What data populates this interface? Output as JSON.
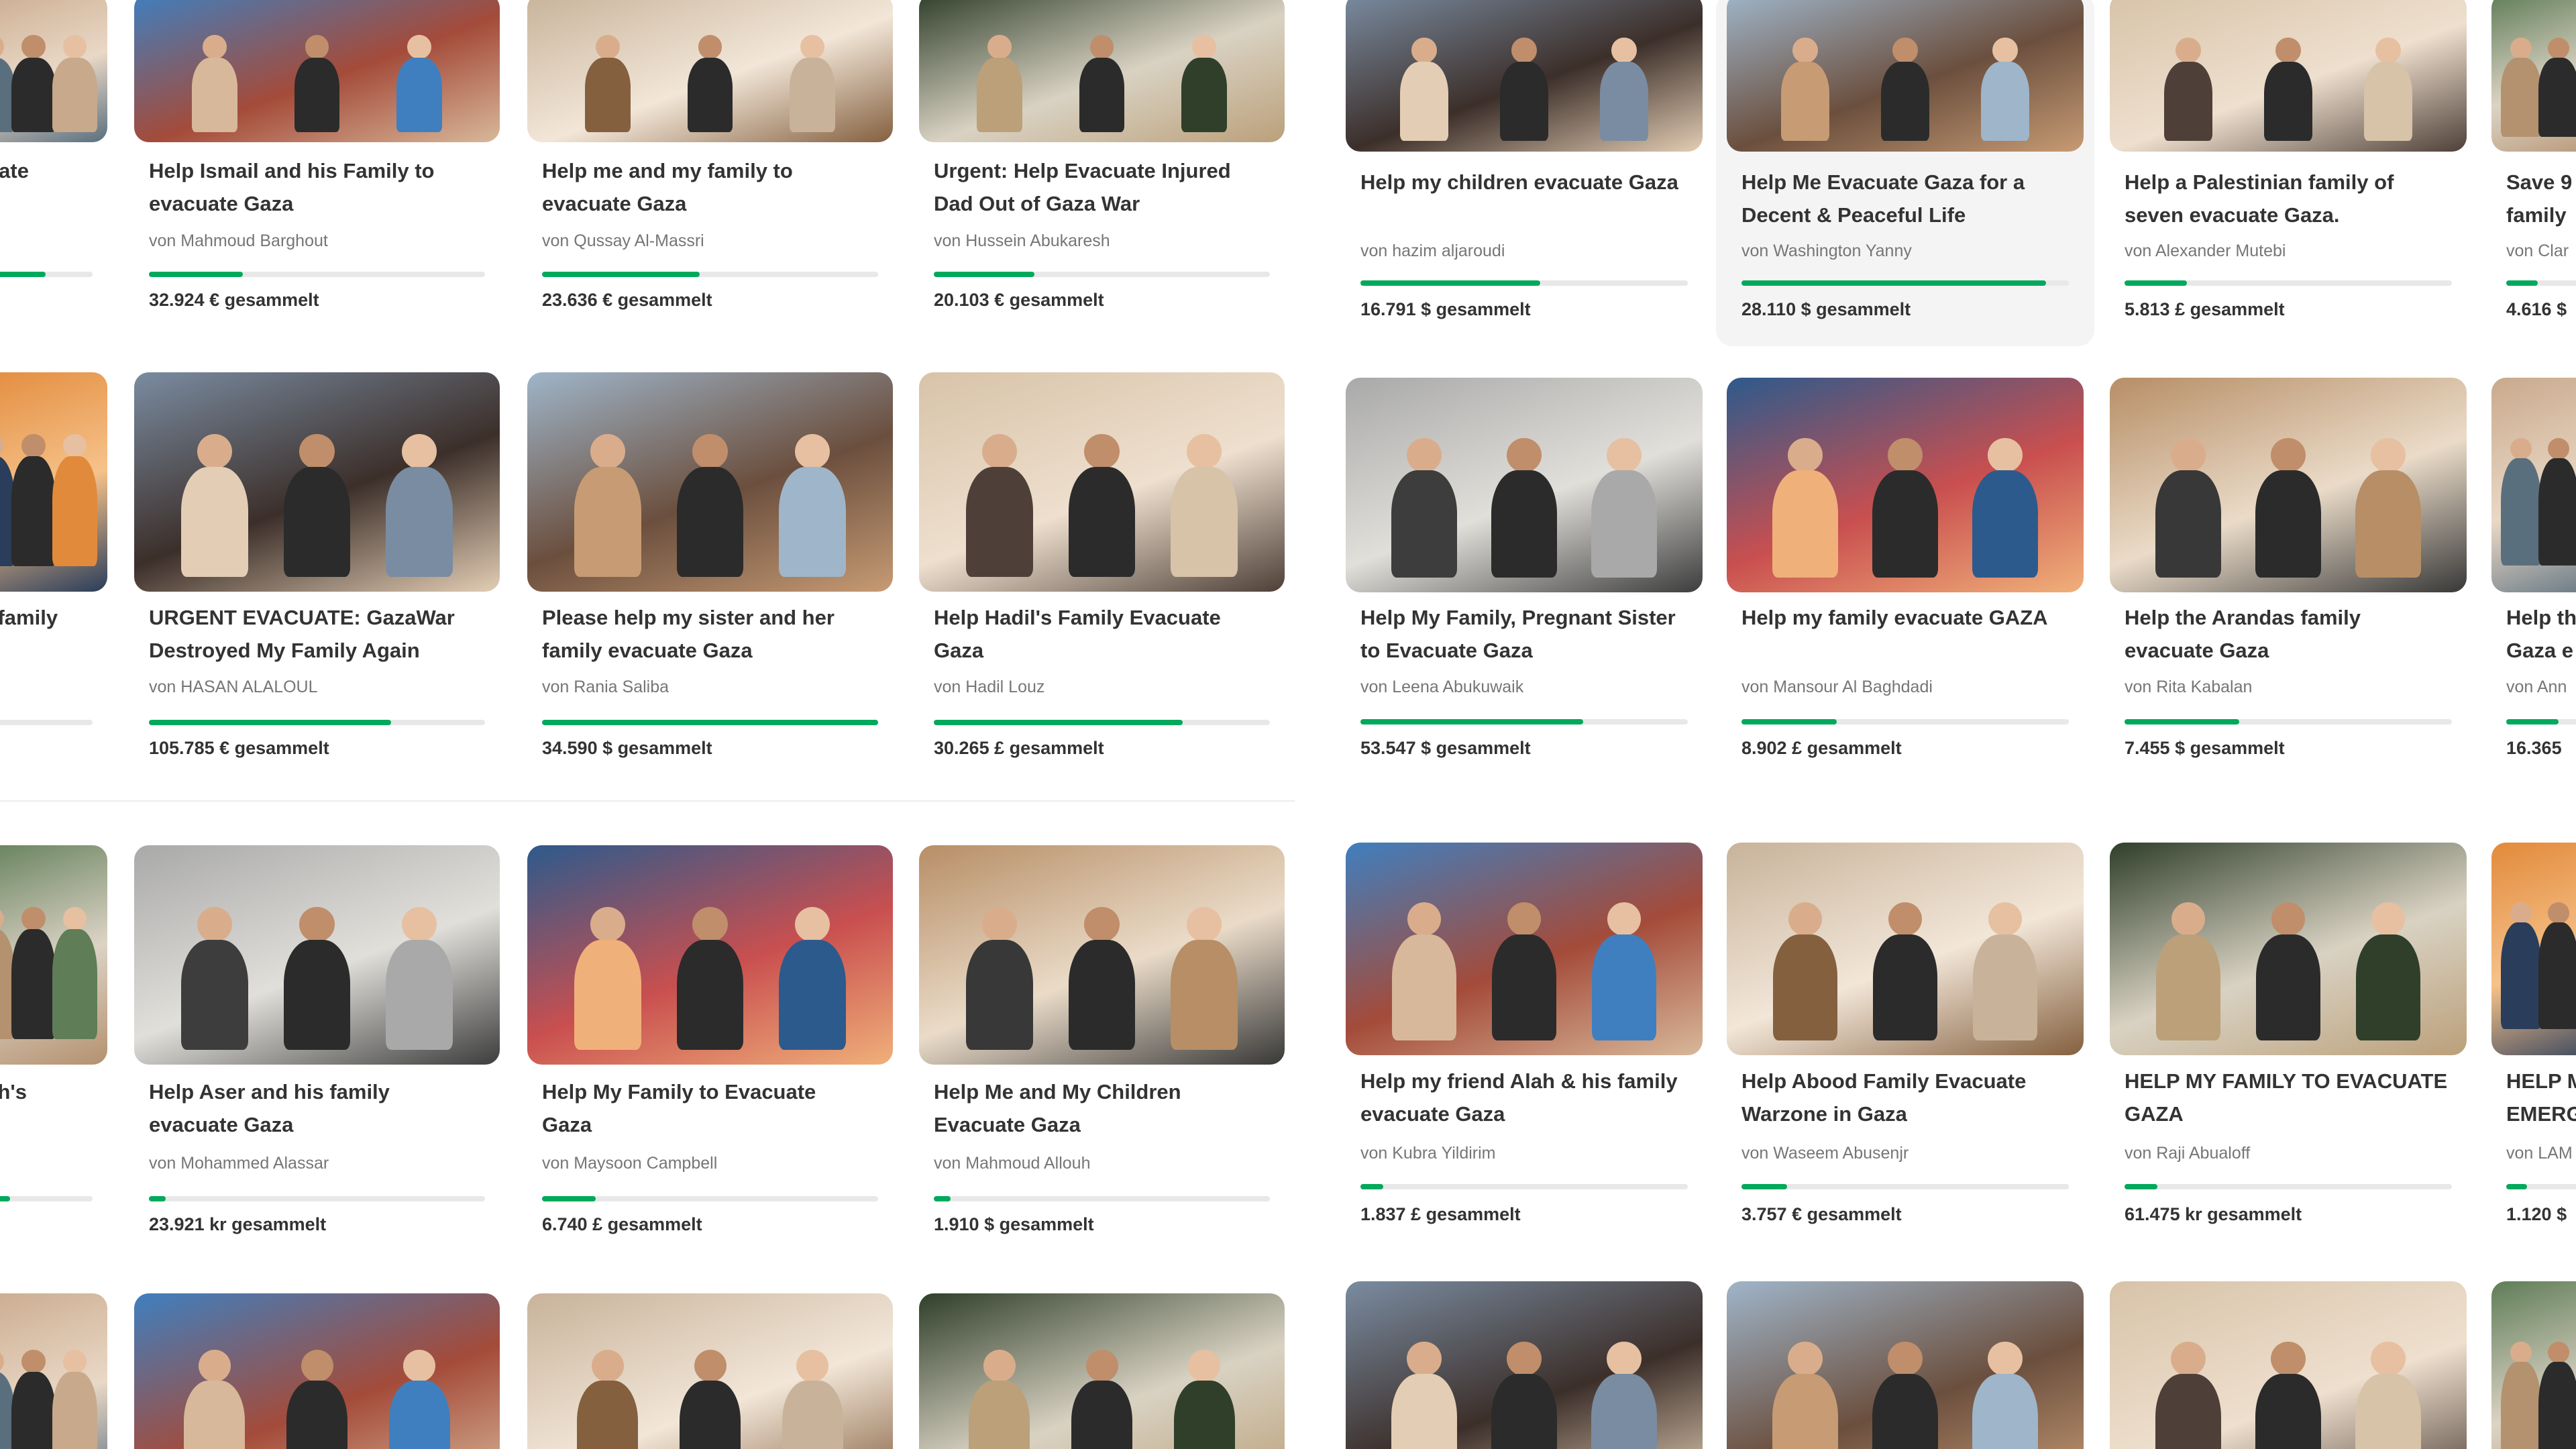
{
  "currency_label": "gesammelt",
  "left_panel": {
    "rows": [
      [
        {
          "title": [
            "",
            "cuate"
          ],
          "organizer": "",
          "raised": "",
          "progress": 0.6
        },
        {
          "title": [
            "Help Ismail and his Family to",
            "evacuate Gaza"
          ],
          "organizer": "von Mahmoud Barghout",
          "raised": "32.924 € gesammelt",
          "progress": 0.28
        },
        {
          "title": [
            "Help me and my family to",
            "evacuate Gaza"
          ],
          "organizer": "von Qussay Al-Massri",
          "raised": "23.636 € gesammelt",
          "progress": 0.47
        },
        {
          "title": [
            "Urgent: Help Evacuate Injured",
            "Dad Out of Gaza War"
          ],
          "organizer": "von Hussein Abukaresh",
          "raised": "20.103 € gesammelt",
          "progress": 0.3
        }
      ],
      [
        {
          "title": [
            "is family",
            ""
          ],
          "organizer": "",
          "raised": "",
          "progress": 0.2
        },
        {
          "title": [
            "URGENT EVACUATE: GazaWar",
            "Destroyed My Family Again"
          ],
          "organizer": "von HASAN ALALOUL",
          "raised": "105.785 € gesammelt",
          "progress": 0.72
        },
        {
          "title": [
            "Please help my sister and her",
            "family evacuate Gaza"
          ],
          "organizer": "von Rania Saliba",
          "raised": "34.590 $ gesammelt",
          "progress": 1.0
        },
        {
          "title": [
            "Help Hadil's Family Evacuate",
            "Gaza"
          ],
          "organizer": "von Hadil Louz",
          "raised": "30.265 £ gesammelt",
          "progress": 0.74
        }
      ],
      [
        {
          "title": [
            "llah's",
            ""
          ],
          "organizer": "",
          "raised": "",
          "progress": 0.3
        },
        {
          "title": [
            "Help Aser and his family",
            "evacuate Gaza"
          ],
          "organizer": "von Mohammed Alassar",
          "raised": "23.921 kr gesammelt",
          "progress": 0.05
        },
        {
          "title": [
            "Help My Family to Evacuate",
            "Gaza"
          ],
          "organizer": "von Maysoon Campbell",
          "raised": "6.740 £ gesammelt",
          "progress": 0.16
        },
        {
          "title": [
            "Help Me and My Children",
            "Evacuate Gaza"
          ],
          "organizer": "von Mahmoud Allouh",
          "raised": "1.910 $ gesammelt",
          "progress": 0.05
        }
      ]
    ]
  },
  "right_panel": {
    "rows": [
      [
        {
          "title": [
            "Help my children evacuate Gaza",
            ""
          ],
          "organizer": "von hazim aljaroudi",
          "raised": "16.791 $ gesammelt",
          "progress": 0.55
        },
        {
          "title": [
            "Help Me Evacuate Gaza for a",
            "Decent & Peaceful Life"
          ],
          "organizer": "von Washington Yanny",
          "raised": "28.110 $ gesammelt",
          "progress": 0.93
        },
        {
          "title": [
            "Help a Palestinian family of",
            "seven evacuate Gaza."
          ],
          "organizer": "von Alexander Mutebi",
          "raised": "5.813 £ gesammelt",
          "progress": 0.19
        },
        {
          "title": [
            "Save 9",
            "family"
          ],
          "organizer": "von Clar",
          "raised": "4.616 $",
          "progress": 0.3
        }
      ],
      [
        {
          "title": [
            "Help My Family, Pregnant Sister",
            "to Evacuate Gaza"
          ],
          "organizer": "von Leena Abukuwaik",
          "raised": "53.547 $ gesammelt",
          "progress": 0.68
        },
        {
          "title": [
            "Help my family evacuate GAZA",
            ""
          ],
          "organizer": "von Mansour Al Baghdadi",
          "raised": "8.902 £ gesammelt",
          "progress": 0.29
        },
        {
          "title": [
            "Help the Arandas family",
            "evacuate Gaza"
          ],
          "organizer": "von Rita Kabalan",
          "raised": "7.455 $ gesammelt",
          "progress": 0.35
        },
        {
          "title": [
            "Help th",
            "Gaza e"
          ],
          "organizer": "von Ann",
          "raised": "16.365",
          "progress": 0.5
        }
      ],
      [
        {
          "title": [
            "Help my friend Alah & his family",
            "evacuate Gaza"
          ],
          "organizer": "von Kubra Yildirim",
          "raised": "1.837 £ gesammelt",
          "progress": 0.07
        },
        {
          "title": [
            "Help Abood Family Evacuate",
            "Warzone in Gaza"
          ],
          "organizer": "von Waseem Abusenjr",
          "raised": "3.757 € gesammelt",
          "progress": 0.14
        },
        {
          "title": [
            "HELP MY FAMILY TO EVACUATE",
            "GAZA"
          ],
          "organizer": "von Raji Abualoff",
          "raised": "61.475 kr gesammelt",
          "progress": 0.1
        },
        {
          "title": [
            "HELP M",
            "EMERG"
          ],
          "organizer": "von LAM",
          "raised": "1.120 $",
          "progress": 0.2
        }
      ]
    ]
  }
}
